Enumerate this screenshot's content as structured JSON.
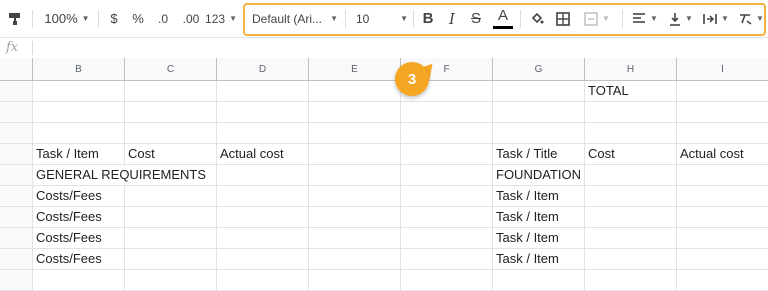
{
  "toolbar": {
    "zoom": "100%",
    "currency": "$",
    "percent": "%",
    "decrease_decimal": ".0",
    "increase_decimal": ".00",
    "more_formats": "123",
    "font_family": "Default (Ari...",
    "font_size": "10",
    "bold": "B",
    "italic": "I",
    "strike": "S",
    "text_color": "A",
    "highlight_color": "#f3b23a"
  },
  "formula_bar": {
    "fx": "fx",
    "value": ""
  },
  "columns": [
    "B",
    "C",
    "D",
    "E",
    "F",
    "G",
    "H",
    "I"
  ],
  "callout": {
    "number": "3",
    "color": "#f5a623"
  },
  "cells": {
    "H1": "TOTAL",
    "B4": "Task  / Item",
    "C4": "Cost",
    "D4": "Actual cost",
    "G4": "Task  / Title",
    "H4": "Cost",
    "I4": "Actual cost",
    "B5": "GENERAL REQUIREMENTS",
    "G5": "FOUNDATION",
    "B6": "Costs/Fees",
    "G6": "Task / Item",
    "B7": "Costs/Fees",
    "G7": "Task / Item",
    "B8": "Costs/Fees",
    "G8": "Task / Item",
    "B9": "Costs/Fees",
    "G9": "Task / Item"
  }
}
